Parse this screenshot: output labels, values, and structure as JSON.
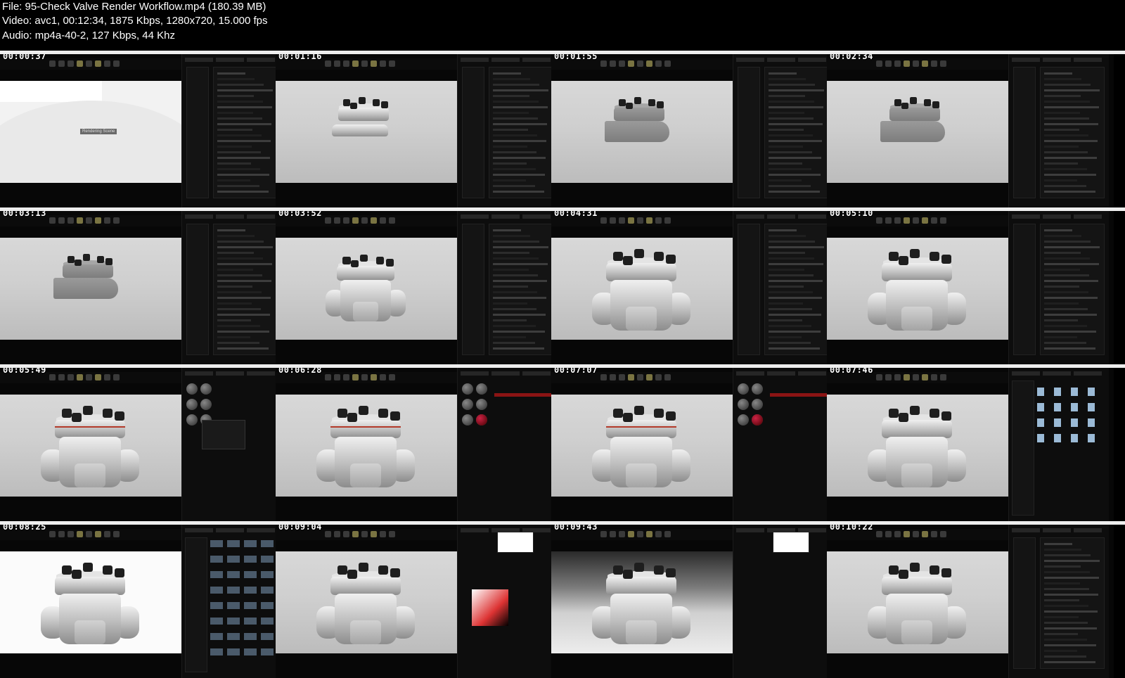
{
  "header": {
    "file_line": "File: 95-Check Valve Render Workflow.mp4 (180.39 MB)",
    "video_line": "Video: avc1, 00:12:34, 1875 Kbps, 1280x720, 15.000 fps",
    "audio_line": "Audio: mp4a-40-2, 127 Kbps, 44 Khz"
  },
  "thumbnails": [
    {
      "timestamp": "00:00:37",
      "scene": "loading",
      "badge": "Rendering Scene"
    },
    {
      "timestamp": "00:01:16",
      "scene": "valve-angled"
    },
    {
      "timestamp": "00:01:55",
      "scene": "valve-clay"
    },
    {
      "timestamp": "00:02:34",
      "scene": "valve-gizmo"
    },
    {
      "timestamp": "00:03:13",
      "scene": "valve-clay"
    },
    {
      "timestamp": "00:03:52",
      "scene": "valve-side"
    },
    {
      "timestamp": "00:04:31",
      "scene": "valve-front"
    },
    {
      "timestamp": "00:05:10",
      "scene": "valve-front"
    },
    {
      "timestamp": "00:05:49",
      "scene": "valve-materials"
    },
    {
      "timestamp": "00:06:28",
      "scene": "valve-materials-red"
    },
    {
      "timestamp": "00:07:07",
      "scene": "valve-materials-red"
    },
    {
      "timestamp": "00:07:46",
      "scene": "valve-library"
    },
    {
      "timestamp": "00:08:25",
      "scene": "valve-environments"
    },
    {
      "timestamp": "00:09:04",
      "scene": "valve-colorpicker"
    },
    {
      "timestamp": "00:09:43",
      "scene": "valve-dark-bg"
    },
    {
      "timestamp": "00:10:22",
      "scene": "valve-camera"
    }
  ],
  "colors": {
    "background": "#000000",
    "separator": "#eeeeee",
    "panel": "#0d0d0d",
    "metal_light": "#e6e6e6",
    "metal_mid": "#a9a9a9",
    "bolt": "#1e1e1e",
    "accent_red": "#8b1414"
  }
}
